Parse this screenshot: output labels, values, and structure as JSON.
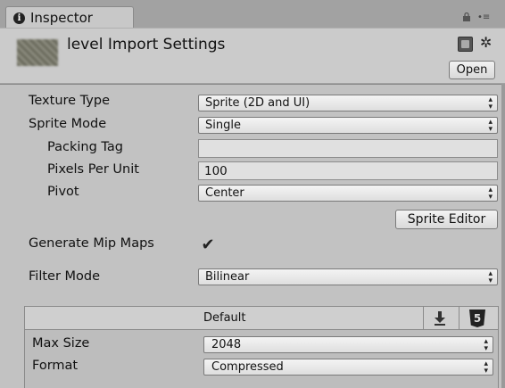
{
  "tab": {
    "title": "Inspector"
  },
  "header": {
    "title": "level Import Settings",
    "open_label": "Open"
  },
  "settings": {
    "texture_type": {
      "label": "Texture Type",
      "value": "Sprite (2D and UI)"
    },
    "sprite_mode": {
      "label": "Sprite Mode",
      "value": "Single"
    },
    "packing_tag": {
      "label": "Packing Tag",
      "value": ""
    },
    "pixels_per_unit": {
      "label": "Pixels Per Unit",
      "value": "100"
    },
    "pivot": {
      "label": "Pivot",
      "value": "Center"
    },
    "sprite_editor_label": "Sprite Editor",
    "generate_mip_maps": {
      "label": "Generate Mip Maps",
      "checked": true
    },
    "filter_mode": {
      "label": "Filter Mode",
      "value": "Bilinear"
    }
  },
  "platform": {
    "default_tab": "Default",
    "max_size": {
      "label": "Max Size",
      "value": "2048"
    },
    "format": {
      "label": "Format",
      "value": "Compressed"
    }
  },
  "icons": {
    "info": "info-icon",
    "lock": "lock-icon",
    "menu": "context-menu-icon",
    "help": "help-book-icon",
    "gear": "gear-icon",
    "download": "download-icon",
    "html5": "html5-icon",
    "checkmark": "checkmark-icon",
    "dropdown_arrow": "dropdown-arrow-icon"
  }
}
